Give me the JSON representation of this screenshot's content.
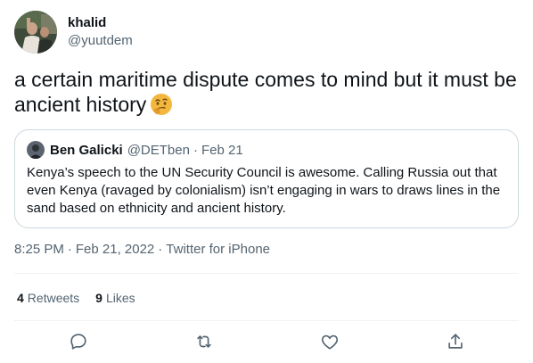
{
  "author": {
    "display_name": "khalid",
    "handle": "@yuutdem"
  },
  "tweet": {
    "text": "a certain maritime dispute comes to mind but it must be ancient history",
    "emoji": "thinking-face-emoji"
  },
  "quoted_tweet": {
    "display_name": "Ben Galicki",
    "handle": "@DETben",
    "separator": "·",
    "date": "Feb 21",
    "text": "Kenya’s speech to the UN Security Council is awesome. Calling Russia out that even Kenya (ravaged by colonialism) isn’t engaging in wars to draws lines in the sand based on ethnicity and ancient history."
  },
  "meta": {
    "time": "8:25 PM",
    "separator": "·",
    "date": "Feb 21, 2022",
    "source": "Twitter for iPhone"
  },
  "stats": {
    "retweets_count": "4",
    "retweets_label": "Retweets",
    "likes_count": "9",
    "likes_label": "Likes"
  },
  "actions": {
    "reply": "reply-icon",
    "retweet": "retweet-icon",
    "like": "heart-icon",
    "share": "share-icon"
  },
  "colors": {
    "text_primary": "#0f1419",
    "text_secondary": "#536471",
    "border": "#cfd9de",
    "divider": "#eff3f4",
    "emoji_yellow": "#f4b73e"
  }
}
